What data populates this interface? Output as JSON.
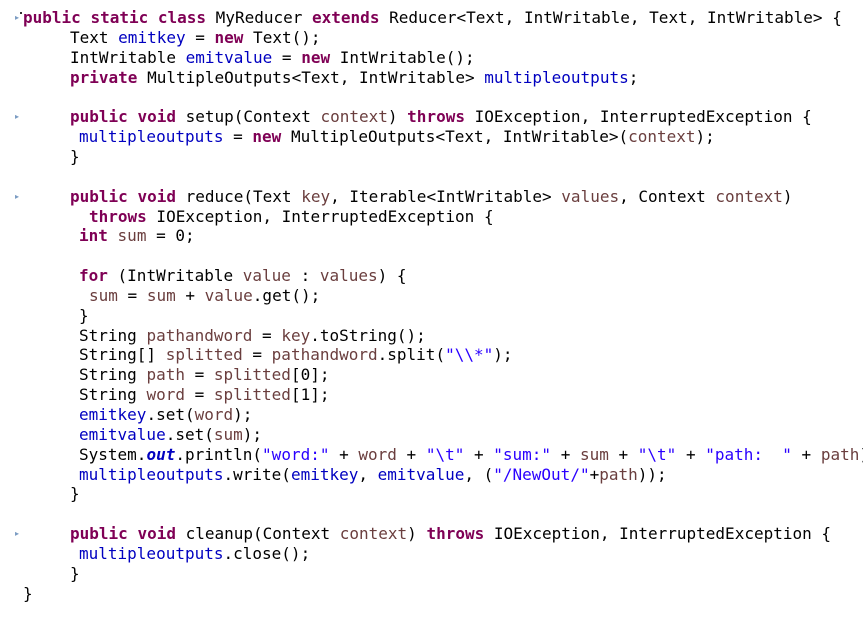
{
  "editor": {
    "lines": [
      {
        "indent": 0,
        "tokens": [
          [
            "kw",
            "public"
          ],
          [
            "pl",
            " "
          ],
          [
            "kw",
            "static"
          ],
          [
            "pl",
            " "
          ],
          [
            "kw",
            "class"
          ],
          [
            "pl",
            " MyReducer "
          ],
          [
            "kw",
            "extends"
          ],
          [
            "pl",
            " Reducer<Text, IntWritable, Text, IntWritable> {"
          ]
        ]
      },
      {
        "indent": 1,
        "tokens": [
          [
            "pl",
            "Text "
          ],
          [
            "fld",
            "emitkey"
          ],
          [
            "pl",
            " = "
          ],
          [
            "kw",
            "new"
          ],
          [
            "pl",
            " Text();"
          ]
        ]
      },
      {
        "indent": 1,
        "tokens": [
          [
            "pl",
            "IntWritable "
          ],
          [
            "fld",
            "emitvalue"
          ],
          [
            "pl",
            " = "
          ],
          [
            "kw",
            "new"
          ],
          [
            "pl",
            " IntWritable();"
          ]
        ]
      },
      {
        "indent": 1,
        "tokens": [
          [
            "kw",
            "private"
          ],
          [
            "pl",
            " MultipleOutputs<Text, IntWritable> "
          ],
          [
            "fld",
            "multipleoutputs"
          ],
          [
            "pl",
            ";"
          ]
        ]
      },
      {
        "indent": 0,
        "tokens": []
      },
      {
        "indent": 1,
        "tokens": [
          [
            "kw",
            "public"
          ],
          [
            "pl",
            " "
          ],
          [
            "kw",
            "void"
          ],
          [
            "pl",
            " setup(Context "
          ],
          [
            "var",
            "context"
          ],
          [
            "pl",
            ") "
          ],
          [
            "kw",
            "throws"
          ],
          [
            "pl",
            " IOException, InterruptedException {"
          ]
        ]
      },
      {
        "indent": 2,
        "tokens": [
          [
            "fld",
            "multipleoutputs"
          ],
          [
            "pl",
            " = "
          ],
          [
            "kw",
            "new"
          ],
          [
            "pl",
            " MultipleOutputs<Text, IntWritable>("
          ],
          [
            "var",
            "context"
          ],
          [
            "pl",
            ");"
          ]
        ]
      },
      {
        "indent": 1,
        "tokens": [
          [
            "pl",
            "}"
          ]
        ]
      },
      {
        "indent": 0,
        "tokens": []
      },
      {
        "indent": 1,
        "tokens": [
          [
            "kw",
            "public"
          ],
          [
            "pl",
            " "
          ],
          [
            "kw",
            "void"
          ],
          [
            "pl",
            " reduce(Text "
          ],
          [
            "var",
            "key"
          ],
          [
            "pl",
            ", Iterable<IntWritable> "
          ],
          [
            "var",
            "values"
          ],
          [
            "pl",
            ", Context "
          ],
          [
            "var",
            "context"
          ],
          [
            "pl",
            ")"
          ]
        ]
      },
      {
        "indent": 3,
        "tokens": [
          [
            "kw",
            "throws"
          ],
          [
            "pl",
            " IOException, InterruptedException {"
          ]
        ]
      },
      {
        "indent": 2,
        "tokens": [
          [
            "kw",
            "int"
          ],
          [
            "pl",
            " "
          ],
          [
            "var",
            "sum"
          ],
          [
            "pl",
            " = 0;"
          ]
        ]
      },
      {
        "indent": 0,
        "tokens": []
      },
      {
        "indent": 2,
        "tokens": [
          [
            "kw",
            "for"
          ],
          [
            "pl",
            " (IntWritable "
          ],
          [
            "var",
            "value"
          ],
          [
            "pl",
            " : "
          ],
          [
            "var",
            "values"
          ],
          [
            "pl",
            ") {"
          ]
        ]
      },
      {
        "indent": 3,
        "tokens": [
          [
            "var",
            "sum"
          ],
          [
            "pl",
            " = "
          ],
          [
            "var",
            "sum"
          ],
          [
            "pl",
            " + "
          ],
          [
            "var",
            "value"
          ],
          [
            "pl",
            ".get();"
          ]
        ]
      },
      {
        "indent": 2,
        "tokens": [
          [
            "pl",
            "}"
          ]
        ]
      },
      {
        "indent": 2,
        "tokens": [
          [
            "pl",
            "String "
          ],
          [
            "var",
            "pathandword"
          ],
          [
            "pl",
            " = "
          ],
          [
            "var",
            "key"
          ],
          [
            "pl",
            ".toString();"
          ]
        ]
      },
      {
        "indent": 2,
        "tokens": [
          [
            "pl",
            "String[] "
          ],
          [
            "var",
            "splitted"
          ],
          [
            "pl",
            " = "
          ],
          [
            "var",
            "pathandword"
          ],
          [
            "pl",
            ".split("
          ],
          [
            "str",
            "\"\\\\*\""
          ],
          [
            "pl",
            ");"
          ]
        ]
      },
      {
        "indent": 2,
        "tokens": [
          [
            "pl",
            "String "
          ],
          [
            "var",
            "path"
          ],
          [
            "pl",
            " = "
          ],
          [
            "var",
            "splitted"
          ],
          [
            "pl",
            "[0];"
          ]
        ]
      },
      {
        "indent": 2,
        "tokens": [
          [
            "pl",
            "String "
          ],
          [
            "var",
            "word"
          ],
          [
            "pl",
            " = "
          ],
          [
            "var",
            "splitted"
          ],
          [
            "pl",
            "[1];"
          ]
        ]
      },
      {
        "indent": 2,
        "tokens": [
          [
            "fld",
            "emitkey"
          ],
          [
            "pl",
            ".set("
          ],
          [
            "var",
            "word"
          ],
          [
            "pl",
            ");"
          ]
        ]
      },
      {
        "indent": 2,
        "tokens": [
          [
            "fld",
            "emitvalue"
          ],
          [
            "pl",
            ".set("
          ],
          [
            "var",
            "sum"
          ],
          [
            "pl",
            ");"
          ]
        ]
      },
      {
        "indent": 2,
        "tokens": [
          [
            "pl",
            "System."
          ],
          [
            "sfld",
            "out"
          ],
          [
            "pl",
            ".println("
          ],
          [
            "str",
            "\"word:\""
          ],
          [
            "pl",
            " + "
          ],
          [
            "var",
            "word"
          ],
          [
            "pl",
            " + "
          ],
          [
            "str",
            "\"\\t\""
          ],
          [
            "pl",
            " + "
          ],
          [
            "str",
            "\"sum:\""
          ],
          [
            "pl",
            " + "
          ],
          [
            "var",
            "sum"
          ],
          [
            "pl",
            " + "
          ],
          [
            "str",
            "\"\\t\""
          ],
          [
            "pl",
            " + "
          ],
          [
            "str",
            "\"path:  \""
          ],
          [
            "pl",
            " + "
          ],
          [
            "var",
            "path"
          ],
          [
            "pl",
            ");"
          ]
        ]
      },
      {
        "indent": 2,
        "tokens": [
          [
            "fld",
            "multipleoutputs"
          ],
          [
            "pl",
            ".write("
          ],
          [
            "fld",
            "emitkey"
          ],
          [
            "pl",
            ", "
          ],
          [
            "fld",
            "emitvalue"
          ],
          [
            "pl",
            ", ("
          ],
          [
            "str",
            "\"/NewOut/\""
          ],
          [
            "pl",
            "+"
          ],
          [
            "var",
            "path"
          ],
          [
            "pl",
            "));"
          ]
        ]
      },
      {
        "indent": 1,
        "tokens": [
          [
            "pl",
            "}"
          ]
        ]
      },
      {
        "indent": 0,
        "tokens": []
      },
      {
        "indent": 1,
        "tokens": [
          [
            "kw",
            "public"
          ],
          [
            "pl",
            " "
          ],
          [
            "kw",
            "void"
          ],
          [
            "pl",
            " cleanup(Context "
          ],
          [
            "var",
            "context"
          ],
          [
            "pl",
            ") "
          ],
          [
            "kw",
            "throws"
          ],
          [
            "pl",
            " IOException, InterruptedException {"
          ]
        ]
      },
      {
        "indent": 2,
        "tokens": [
          [
            "fld",
            "multipleoutputs"
          ],
          [
            "pl",
            ".close();"
          ]
        ]
      },
      {
        "indent": 1,
        "tokens": [
          [
            "pl",
            "}"
          ]
        ]
      },
      {
        "indent": 0,
        "tokens": [
          [
            "pl",
            "}"
          ]
        ]
      }
    ],
    "fold_markers": [
      0,
      5,
      9,
      26
    ]
  }
}
